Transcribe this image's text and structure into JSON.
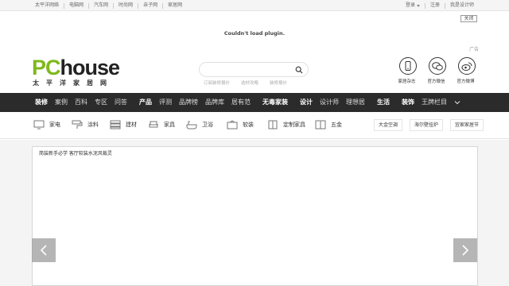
{
  "topbar": {
    "sites": [
      "太平洋网络",
      "电脑网",
      "汽车网",
      "时尚网",
      "亲子网",
      "家居网"
    ],
    "login": "登录",
    "register": "注册",
    "my_design": "我是设计师"
  },
  "ad": {
    "close_label": "关闭",
    "plugin_message": "Couldn't load plugin.",
    "ad_tag": "广告"
  },
  "logo": {
    "brand_pc": "PC",
    "brand_house": "house",
    "brand_cn": "太平洋家居网"
  },
  "search": {
    "placeholder": "",
    "hot_links": [
      "订阅装修报价",
      "选材攻略",
      "装修报价"
    ]
  },
  "apps": [
    {
      "label": "家居杂志",
      "icon": "phone-icon"
    },
    {
      "label": "官方微信",
      "icon": "wechat-icon"
    },
    {
      "label": "官方微博",
      "icon": "weibo-icon"
    }
  ],
  "nav": {
    "items": [
      {
        "label": "装修",
        "bold": true
      },
      {
        "label": "案例",
        "bold": false
      },
      {
        "label": "百科",
        "bold": false
      },
      {
        "label": "专区",
        "bold": false
      },
      {
        "label": "问答",
        "bold": false
      },
      {
        "label": "产品",
        "bold": true
      },
      {
        "label": "评测",
        "bold": false
      },
      {
        "label": "品牌榜",
        "bold": false
      },
      {
        "label": "品牌库",
        "bold": false
      },
      {
        "label": "居有范",
        "bold": false
      },
      {
        "label": "无毒家装",
        "bold": true
      },
      {
        "label": "设计",
        "bold": true
      },
      {
        "label": "设计师",
        "bold": false
      },
      {
        "label": "理想居",
        "bold": false
      },
      {
        "label": "生活",
        "bold": true
      },
      {
        "label": "装饰",
        "bold": true
      },
      {
        "label": "王牌栏目",
        "bold": false
      }
    ]
  },
  "categories": [
    {
      "label": "家电",
      "icon": "tv-icon"
    },
    {
      "label": "涂料",
      "icon": "paint-roller-icon"
    },
    {
      "label": "建材",
      "icon": "building-material-icon"
    },
    {
      "label": "家具",
      "icon": "sofa-icon"
    },
    {
      "label": "卫浴",
      "icon": "bathtub-icon"
    },
    {
      "label": "软装",
      "icon": "soft-decor-icon"
    },
    {
      "label": "定制家具",
      "icon": "cabinet-icon"
    },
    {
      "label": "五金",
      "icon": "hardware-icon"
    }
  ],
  "category_buttons": [
    "大金空调",
    "海尔壁挂炉",
    "宜家家居节"
  ],
  "slider": {
    "caption": "简装新手必学 客厅软装水泥风裁灵"
  },
  "colors": {
    "brand_green": "#7fb81b",
    "nav_bg": "#2b2b2b"
  }
}
